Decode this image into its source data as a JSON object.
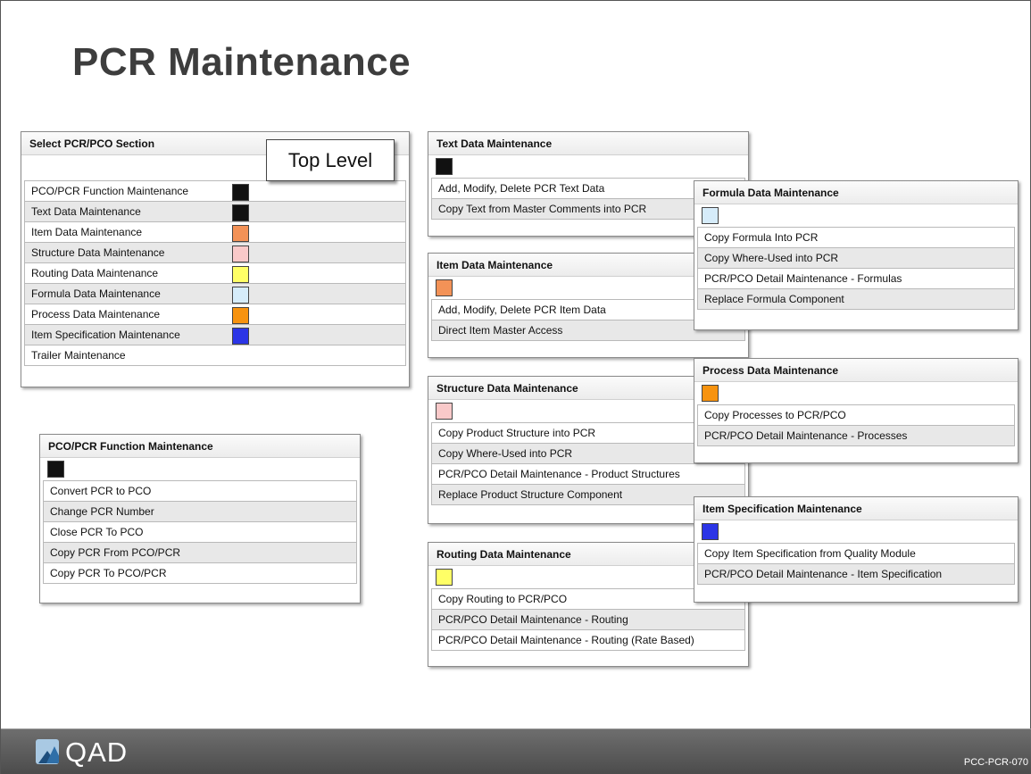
{
  "slide": {
    "title": "PCR Maintenance",
    "callout": "Top Level"
  },
  "select_panel": {
    "header": "Select PCR/PCO Section",
    "rows": [
      {
        "label": "PCO/PCR Function Maintenance",
        "color": "#111111"
      },
      {
        "label": "Text Data Maintenance",
        "color": "#111111"
      },
      {
        "label": "Item Data Maintenance",
        "color": "#f39257"
      },
      {
        "label": "Structure Data Maintenance",
        "color": "#f9c9c9"
      },
      {
        "label": "Routing Data Maintenance",
        "color": "#ffff66"
      },
      {
        "label": "Formula Data Maintenance",
        "color": "#d6ecfa"
      },
      {
        "label": "Process Data Maintenance",
        "color": "#f7930f"
      },
      {
        "label": "Item Specification Maintenance",
        "color": "#2b35e6"
      },
      {
        "label": "Trailer Maintenance",
        "color": ""
      }
    ]
  },
  "function_panel": {
    "header": "PCO/PCR Function Maintenance",
    "color": "#111111",
    "rows": [
      "Convert PCR to PCO",
      "Change PCR Number",
      "Close PCR To PCO",
      "Copy PCR From PCO/PCR",
      "Copy PCR To PCO/PCR"
    ]
  },
  "text_panel": {
    "header": "Text Data Maintenance",
    "color": "#111111",
    "rows": [
      "Add, Modify, Delete PCR Text Data",
      "Copy Text from Master Comments into PCR"
    ]
  },
  "item_panel": {
    "header": "Item Data Maintenance",
    "color": "#f39257",
    "rows": [
      "Add, Modify, Delete PCR Item Data",
      "Direct Item Master Access"
    ]
  },
  "structure_panel": {
    "header": "Structure Data Maintenance",
    "color": "#f9c9c9",
    "rows": [
      "Copy Product Structure into PCR",
      "Copy Where-Used into PCR",
      "PCR/PCO Detail Maintenance - Product Structures",
      "Replace Product Structure Component"
    ]
  },
  "routing_panel": {
    "header": "Routing Data Maintenance",
    "color": "#ffff66",
    "rows": [
      "Copy Routing to PCR/PCO",
      "PCR/PCO Detail Maintenance - Routing",
      "PCR/PCO Detail Maintenance - Routing (Rate Based)"
    ]
  },
  "formula_panel": {
    "header": "Formula Data Maintenance",
    "color": "#d6ecfa",
    "rows": [
      "Copy Formula Into PCR",
      "Copy Where-Used into PCR",
      "PCR/PCO Detail Maintenance - Formulas",
      "Replace Formula Component"
    ]
  },
  "process_panel": {
    "header": "Process Data Maintenance",
    "color": "#f7930f",
    "rows": [
      "Copy Processes to PCR/PCO",
      "PCR/PCO Detail Maintenance - Processes"
    ]
  },
  "itemspec_panel": {
    "header": "Item Specification Maintenance",
    "color": "#2b35e6",
    "rows": [
      "Copy Item Specification from Quality Module",
      "PCR/PCO Detail Maintenance - Item Specification"
    ]
  },
  "footer": {
    "logo_text": "QAD",
    "slide_code": "PCC-PCR-070"
  }
}
